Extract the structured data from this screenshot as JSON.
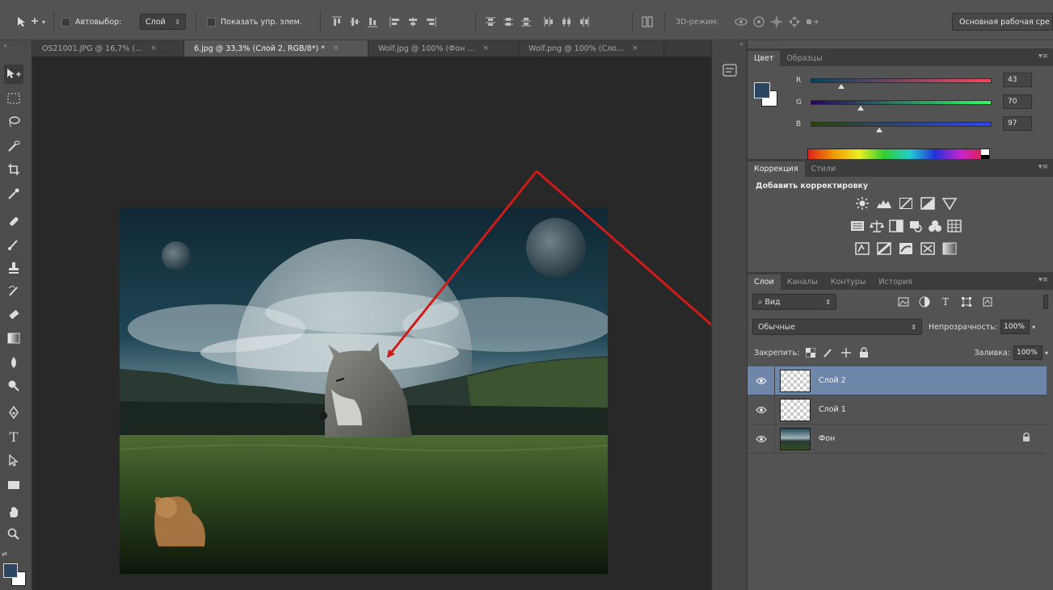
{
  "options_bar": {
    "auto_select_label": "Автовыбор:",
    "auto_select_value": "Слой",
    "show_transform_label": "Показать упр. элем.",
    "mode_3d_label": "3D-режим:",
    "workspace_label": "Основная рабочая сре"
  },
  "tabs": [
    {
      "label": "OS21001.JPG @ 16,7% (..."
    },
    {
      "label": "6.jpg @ 33,3% (Слой 2, RGB/8*) *"
    },
    {
      "label": "Wolf.jpg @ 100% (Фон ..."
    },
    {
      "label": "Wolf.png @ 100% (Сло..."
    }
  ],
  "color_panel": {
    "tabs": [
      "Цвет",
      "Образцы"
    ],
    "fg_color": "#2b4561",
    "bg_color": "#ffffff",
    "channels": [
      {
        "label": "R",
        "value": "43",
        "fraction": 0.169
      },
      {
        "label": "G",
        "value": "70",
        "fraction": 0.275
      },
      {
        "label": "B",
        "value": "97",
        "fraction": 0.38
      }
    ]
  },
  "adjustments_panel": {
    "tabs": [
      "Коррекция",
      "Стили"
    ],
    "title": "Добавить корректировку"
  },
  "layers_panel": {
    "tabs": [
      "Слои",
      "Каналы",
      "Контуры",
      "История"
    ],
    "filter_value": "Вид",
    "blend_mode": "Обычные",
    "opacity_label": "Непрозрачность:",
    "opacity_value": "100%",
    "lock_label": "Закрепить:",
    "fill_label": "Заливка:",
    "fill_value": "100%",
    "layers": [
      {
        "name": "Слой 2",
        "selected": true
      },
      {
        "name": "Слой 1",
        "selected": false
      },
      {
        "name": "Фон",
        "selected": false,
        "locked": true
      }
    ]
  },
  "colors": {
    "arrow": "#d11a1a",
    "selection": "#6e86a9"
  }
}
